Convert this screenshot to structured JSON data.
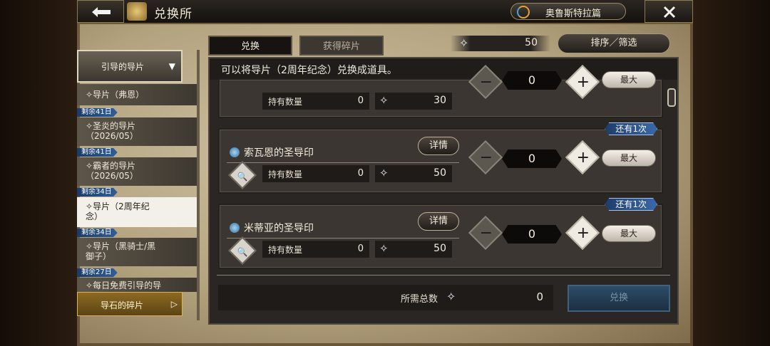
{
  "header": {
    "back_icon": "arrow-left-icon",
    "title": "兑换所",
    "story_label": "奥鲁斯特拉篇",
    "close_icon": "close-icon"
  },
  "tabs": [
    {
      "label": "兑换",
      "active": true
    },
    {
      "label": "获得碎片",
      "active": false
    }
  ],
  "currency": {
    "icon": "crystal-icon",
    "value": "50"
  },
  "sort_filter_label": "排序／筛选",
  "sidebar": {
    "category": "引导的导片",
    "items": [
      {
        "badge": "",
        "label": "导片（弗恩）"
      },
      {
        "badge": "剩余41日",
        "label": "圣炎的导片\n（2026/05）"
      },
      {
        "badge": "剩余41日",
        "label": "霸者的导片\n（2026/05）"
      },
      {
        "badge": "剩余34日",
        "label": "导片（2周年纪\n念）",
        "active": true
      },
      {
        "badge": "剩余34日",
        "label": "导片（黑骑士/黑\n御子）"
      },
      {
        "badge": "剩余27日",
        "label": "每日免费引导的导"
      }
    ],
    "bottom_category": "导石的碎片"
  },
  "notice": "可以将导片（2周年纪念）兑换成道具。",
  "rows": [
    {
      "name": "",
      "hold_label": "持有数量",
      "hold_value": "0",
      "cost": "30",
      "qty": "0",
      "max_label": "最大",
      "limit": ""
    },
    {
      "name": "索瓦恩的圣导印",
      "detail_label": "详情",
      "hold_label": "持有数量",
      "hold_value": "0",
      "cost": "50",
      "qty": "0",
      "max_label": "最大",
      "limit": "还有1次"
    },
    {
      "name": "米蒂亚的圣导印",
      "detail_label": "详情",
      "hold_label": "持有数量",
      "hold_value": "0",
      "cost": "50",
      "qty": "0",
      "max_label": "最大",
      "limit": "还有1次"
    }
  ],
  "total": {
    "label": "所需总数",
    "value": "0"
  },
  "exchange_button": "兑换",
  "colors": {
    "accent_blue": "#2f5f9c",
    "panel": "#2a2623",
    "parchment": "#cfc3a6"
  }
}
